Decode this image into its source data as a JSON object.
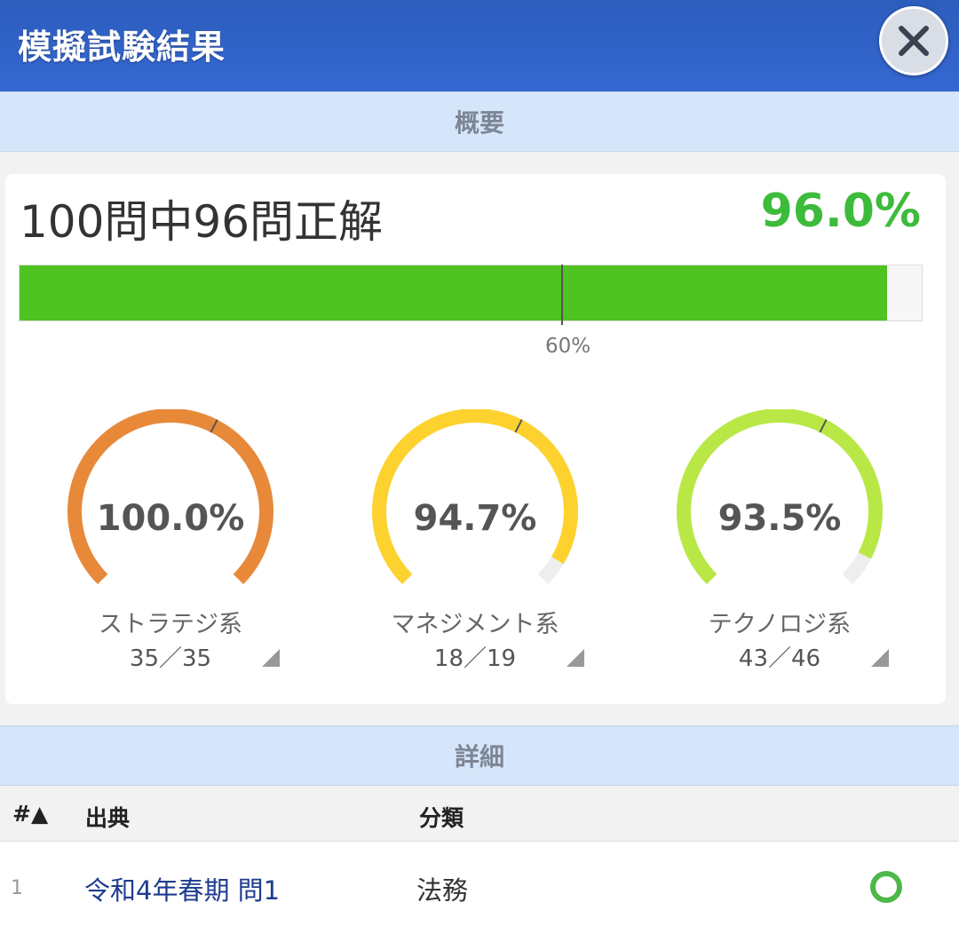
{
  "header": {
    "title": "模擬試験結果",
    "close_icon": "close-icon"
  },
  "sections": {
    "overview": "概要",
    "details": "詳細"
  },
  "summary": {
    "text": "100問中96問正解",
    "percent_text": "96.0%",
    "score_fraction": 0.96,
    "pass_mark_fraction": 0.6,
    "pass_mark_label": "60%",
    "bar_color": "#4ec321",
    "percent_color": "#3dbb3a"
  },
  "gauges": [
    {
      "label": "ストラテジ系",
      "count": "35／35",
      "value_text": "100.0%",
      "fraction": 1.0,
      "color": "#e8893a"
    },
    {
      "label": "マネジメント系",
      "count": "18／19",
      "value_text": "94.7%",
      "fraction": 0.947,
      "color": "#fdd22e"
    },
    {
      "label": "テクノロジ系",
      "count": "43／46",
      "value_text": "93.5%",
      "fraction": 0.935,
      "color": "#b9e846"
    }
  ],
  "table": {
    "columns": {
      "num": "#▲",
      "source": "出典",
      "category": "分類"
    },
    "rows": [
      {
        "num": "1",
        "source": "令和4年春期 問1",
        "category": "法務",
        "result_icon": "circle-correct-icon"
      }
    ]
  }
}
